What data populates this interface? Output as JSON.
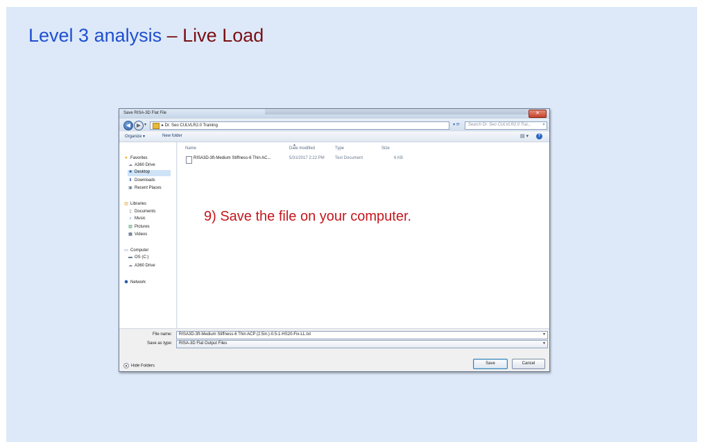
{
  "slide": {
    "title_part1": "Level 3 analysis",
    "title_dash": " – ",
    "title_part2": "Live Load",
    "instruction": "9) Save the file on your computer."
  },
  "colors": {
    "slide_bg": "#dde9f9",
    "title_blue": "#1f4fd1",
    "title_maroon": "#7a0f14",
    "instruction_red": "#c4161c"
  },
  "dialog": {
    "title": "Save RISA-3D Flat File",
    "address_path": "▸ Dr. Seo CULVLR2.0 Training",
    "search_placeholder": "Search Dr. Seo CULVLR2.0 Trai...",
    "toolbar": {
      "organize": "Organize ▾",
      "new_folder": "New folder"
    },
    "nav": {
      "favorites": "Favorites",
      "a360_drive": "A360 Drive",
      "desktop": "Desktop",
      "downloads": "Downloads",
      "recent_places": "Recent Places",
      "libraries": "Libraries",
      "documents": "Documents",
      "music": "Music",
      "pictures": "Pictures",
      "videos": "Videos",
      "computer": "Computer",
      "os_c": "OS (C:)",
      "a360_drive_2": "A360 Drive",
      "network": "Network"
    },
    "columns": {
      "name": "Name",
      "date_modified": "Date modified",
      "type": "Type",
      "size": "Size"
    },
    "file": {
      "name": "RISA3D-3ft-Medium Stiffness-6 Thin AC...",
      "date": "5/31/2017 2:22 PM",
      "type": "Text Document",
      "size": "6 KB"
    },
    "file_name_label": "File name:",
    "file_name_value": "RISA3D-3ft-Medium Stiffness-6 Thin ACP (2.5in.)-0.5-1-HS20-Fix-LL.txt",
    "save_as_type_label": "Save as type:",
    "save_as_type_value": "RISA-3D Flat Output Files",
    "hide_folders": "Hide Folders",
    "save": "Save",
    "cancel": "Cancel",
    "close_glyph": "✕"
  }
}
